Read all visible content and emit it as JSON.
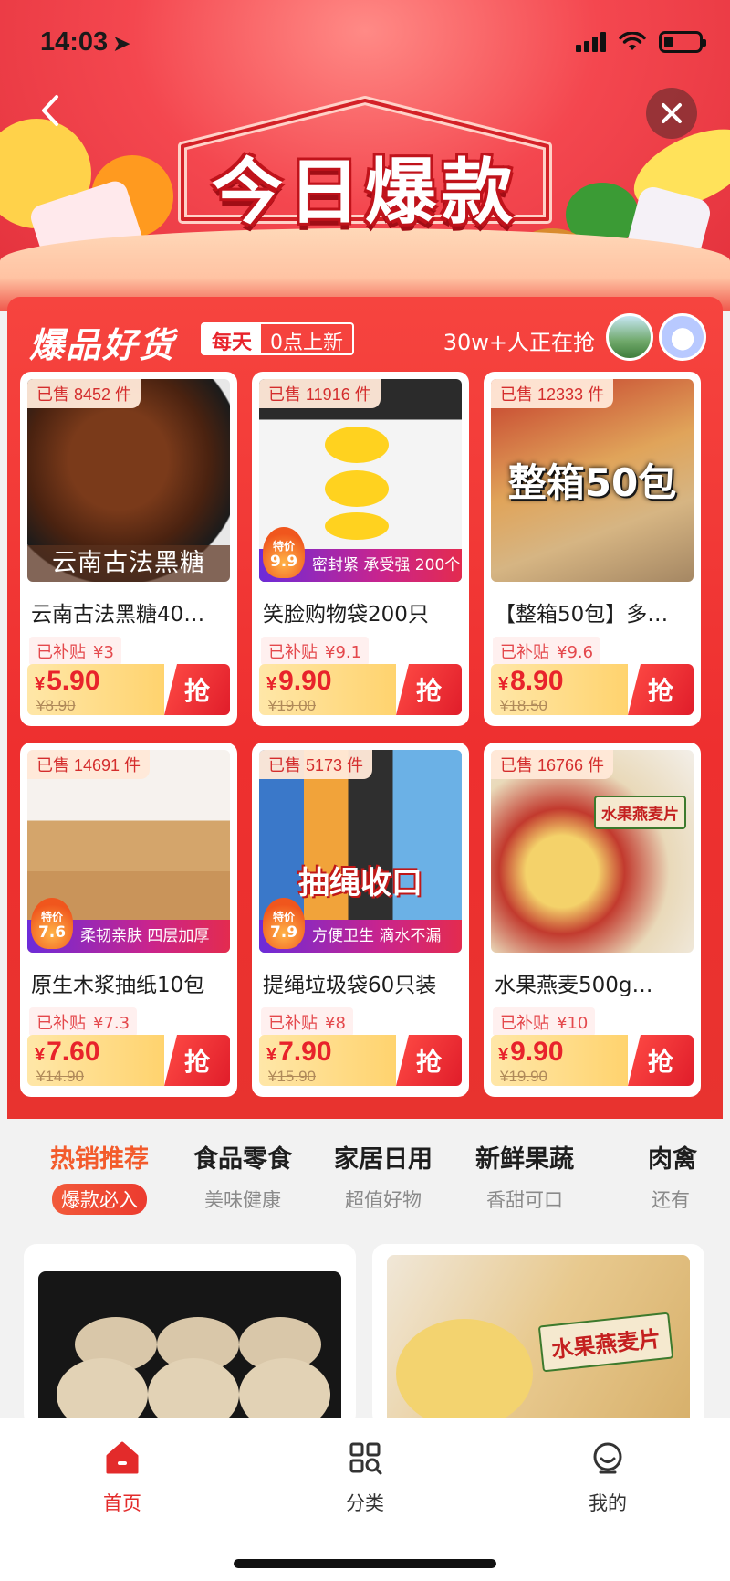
{
  "status_bar": {
    "time": "14:03"
  },
  "banner": {
    "title": "今日爆款"
  },
  "section": {
    "title": "爆品好货",
    "tag_primary": "每天",
    "tag_secondary": "0点上新",
    "grab_count": "30w+人正在抢"
  },
  "products": [
    {
      "sold": "已售 8452 件",
      "image_caption": "云南古法黑糖",
      "name": "云南古法黑糖40…",
      "subsidy_label": "已补贴",
      "subsidy_value": "¥3",
      "price_symbol": "¥",
      "price": "5.90",
      "original_price": "¥8.90",
      "buy_label": "抢"
    },
    {
      "sold": "已售 11916 件",
      "promo_badge_top": "特价",
      "promo_badge_price": "9.9",
      "promo_text": "密封紧 承受强 200个",
      "name": "笑脸购物袋200只",
      "subsidy_label": "已补贴",
      "subsidy_value": "¥9.1",
      "price_symbol": "¥",
      "price": "9.90",
      "original_price": "¥19.00",
      "buy_label": "抢"
    },
    {
      "sold": "已售 12333 件",
      "image_text": "整箱50包",
      "name": "【整箱50包】多…",
      "subsidy_label": "已补贴",
      "subsidy_value": "¥9.6",
      "price_symbol": "¥",
      "price": "8.90",
      "original_price": "¥18.50",
      "buy_label": "抢"
    },
    {
      "sold": "已售 14691 件",
      "promo_badge_top": "特价",
      "promo_badge_price": "7.6",
      "promo_text": "柔韧亲肤 四层加厚",
      "name": "原生木浆抽纸10包",
      "subsidy_label": "已补贴",
      "subsidy_value": "¥7.3",
      "price_symbol": "¥",
      "price": "7.60",
      "original_price": "¥14.90",
      "buy_label": "抢"
    },
    {
      "sold": "已售 5173 件",
      "promo_badge_top": "特价",
      "promo_badge_price": "7.9",
      "promo_text": "方便卫生 滴水不漏",
      "image_text": "抽绳收口",
      "name": "提绳垃圾袋60只装",
      "subsidy_label": "已补贴",
      "subsidy_value": "¥8",
      "price_symbol": "¥",
      "price": "7.90",
      "original_price": "¥15.90",
      "buy_label": "抢"
    },
    {
      "sold": "已售 16766 件",
      "image_text": "水果燕麦片",
      "name": "水果燕麦500g…",
      "subsidy_label": "已补贴",
      "subsidy_value": "¥10",
      "price_symbol": "¥",
      "price": "9.90",
      "original_price": "¥19.90",
      "buy_label": "抢"
    }
  ],
  "tabs": [
    {
      "title": "热销推荐",
      "subtitle": "爆款必入",
      "active": true
    },
    {
      "title": "食品零食",
      "subtitle": "美味健康"
    },
    {
      "title": "家居日用",
      "subtitle": "超值好物"
    },
    {
      "title": "新鲜果蔬",
      "subtitle": "香甜可口"
    },
    {
      "title": "肉禽",
      "subtitle": "还有"
    }
  ],
  "feed": {
    "card2_text": "水果燕麦片"
  },
  "bottom_nav": [
    {
      "label": "首页",
      "icon": "home-icon",
      "active": true
    },
    {
      "label": "分类",
      "icon": "category-icon"
    },
    {
      "label": "我的",
      "icon": "profile-icon"
    }
  ],
  "colors": {
    "brand_red": "#e8232b",
    "accent_orange": "#f35b2c",
    "price_bar": "#ffd36e"
  }
}
